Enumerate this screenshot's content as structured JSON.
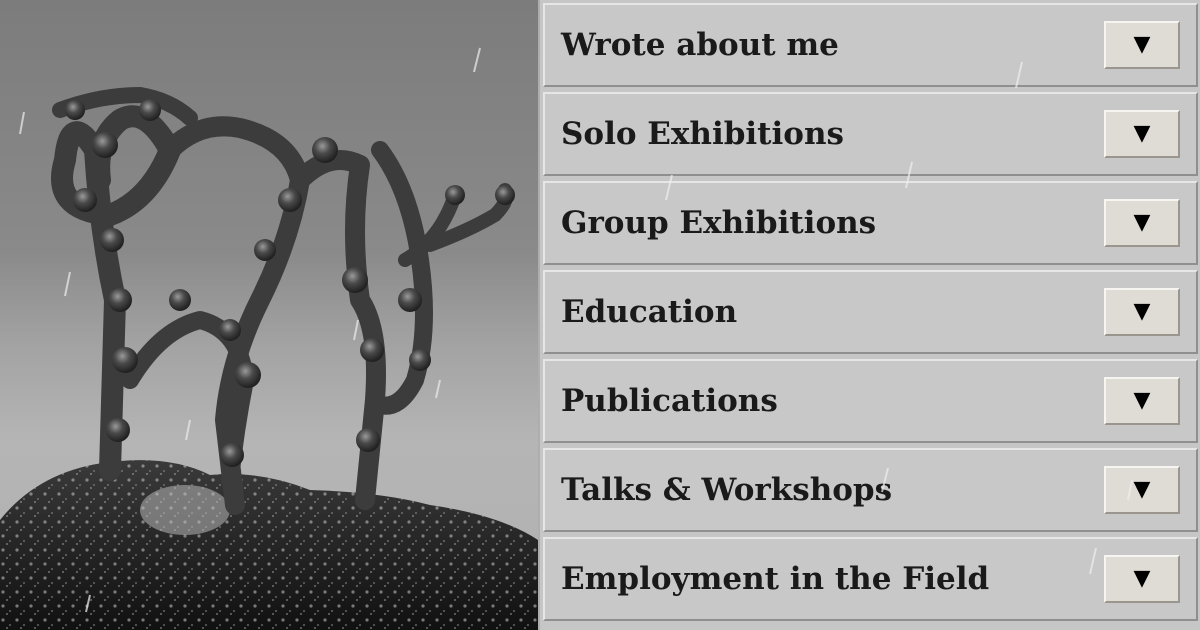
{
  "menu": {
    "items": [
      {
        "label": "Wrote about me",
        "toggle_icon": "▼"
      },
      {
        "label": "Solo Exhibitions",
        "toggle_icon": "▼"
      },
      {
        "label": "Group Exhibitions",
        "toggle_icon": "▼"
      },
      {
        "label": "Education",
        "toggle_icon": "▼"
      },
      {
        "label": "Publications",
        "toggle_icon": "▼"
      },
      {
        "label": "Talks & Workshops",
        "toggle_icon": "▼"
      },
      {
        "label": "Employment in the Field",
        "toggle_icon": "▼"
      }
    ]
  },
  "photo": {
    "subject": "wire-sculpture-on-rock-photo"
  },
  "colors": {
    "menu_bg": "#c8c8c8",
    "button_bg": "#dfdcd6",
    "text": "#1a1a1a"
  }
}
